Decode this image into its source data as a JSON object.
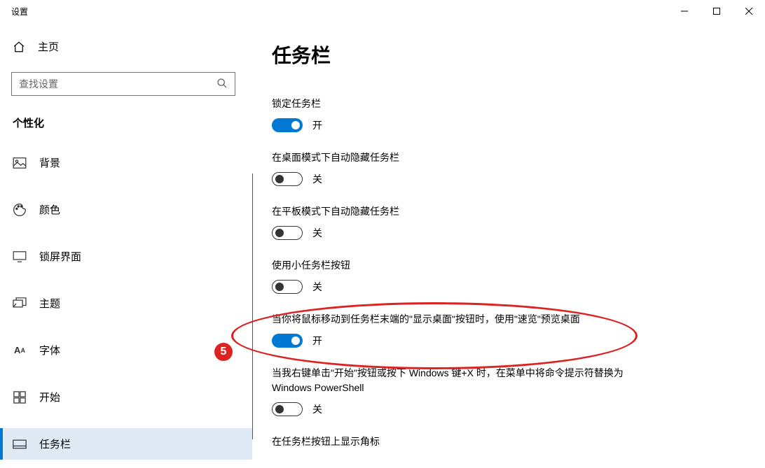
{
  "window": {
    "title": "设置"
  },
  "sidebar": {
    "home": "主页",
    "search_placeholder": "查找设置",
    "section": "个性化",
    "items": [
      {
        "label": "背景"
      },
      {
        "label": "颜色"
      },
      {
        "label": "锁屏界面"
      },
      {
        "label": "主题"
      },
      {
        "label": "字体"
      },
      {
        "label": "开始"
      },
      {
        "label": "任务栏"
      }
    ]
  },
  "page": {
    "title": "任务栏",
    "settings": [
      {
        "label": "锁定任务栏",
        "on": true,
        "state": "开"
      },
      {
        "label": "在桌面模式下自动隐藏任务栏",
        "on": false,
        "state": "关"
      },
      {
        "label": "在平板模式下自动隐藏任务栏",
        "on": false,
        "state": "关"
      },
      {
        "label": "使用小任务栏按钮",
        "on": false,
        "state": "关"
      },
      {
        "label": "当你将鼠标移动到任务栏末端的\"显示桌面\"按钮时，使用\"速览\"预览桌面",
        "on": true,
        "state": "开"
      },
      {
        "label": "当我右键单击\"开始\"按钮或按下 Windows 键+X 时，在菜单中将命令提示符替换为 Windows PowerShell",
        "on": false,
        "state": "关"
      },
      {
        "label": "在任务栏按钮上显示角标",
        "on": null,
        "state": ""
      }
    ]
  },
  "annotation": {
    "badge": "5"
  }
}
